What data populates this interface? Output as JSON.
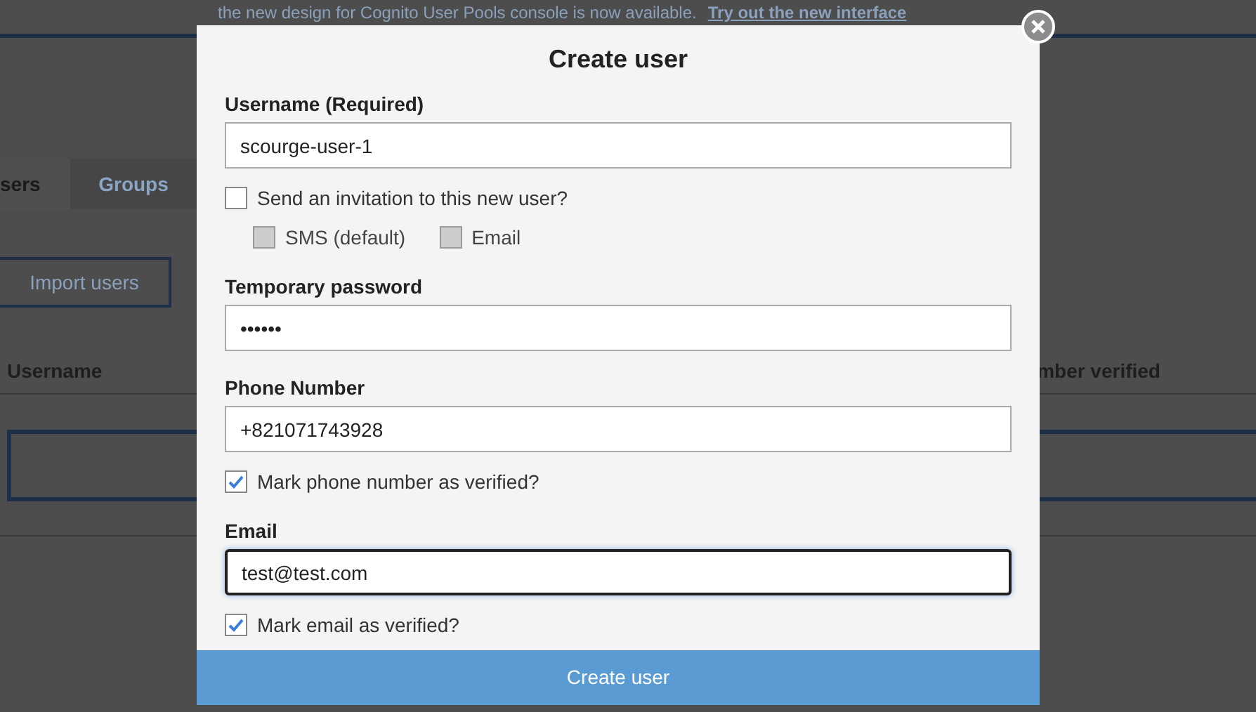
{
  "banner": {
    "text": "the new design for Cognito User Pools console is now available.",
    "link": "Try out the new interface"
  },
  "tabs": [
    {
      "label": "sers",
      "selected": true
    },
    {
      "label": "Groups",
      "selected": false
    }
  ],
  "import_button": "Import users",
  "table": {
    "columns": [
      "Username",
      "mber verified"
    ]
  },
  "dialog": {
    "title": "Create user",
    "items": [
      {
        "kind": "field",
        "label": "Username (Required)",
        "value": "scourge-user-1",
        "focused": false
      },
      {
        "kind": "checkbox",
        "label": "Send an invitation to this new user?",
        "checked": false
      },
      {
        "kind": "options",
        "options": [
          {
            "label": "SMS (default)",
            "checked": false,
            "disabled": true
          },
          {
            "label": "Email",
            "checked": false,
            "disabled": true
          }
        ]
      },
      {
        "kind": "field",
        "label": "Temporary password",
        "value": "••••••",
        "focused": false
      },
      {
        "kind": "field",
        "label": "Phone Number",
        "value": "+821071743928",
        "focused": false
      },
      {
        "kind": "checkbox",
        "label": "Mark phone number as verified?",
        "checked": true
      },
      {
        "kind": "field",
        "label": "Email",
        "value": "test@test.com",
        "focused": true
      },
      {
        "kind": "checkbox",
        "label": "Mark email as verified?",
        "checked": true
      }
    ],
    "submit": "Create user"
  }
}
